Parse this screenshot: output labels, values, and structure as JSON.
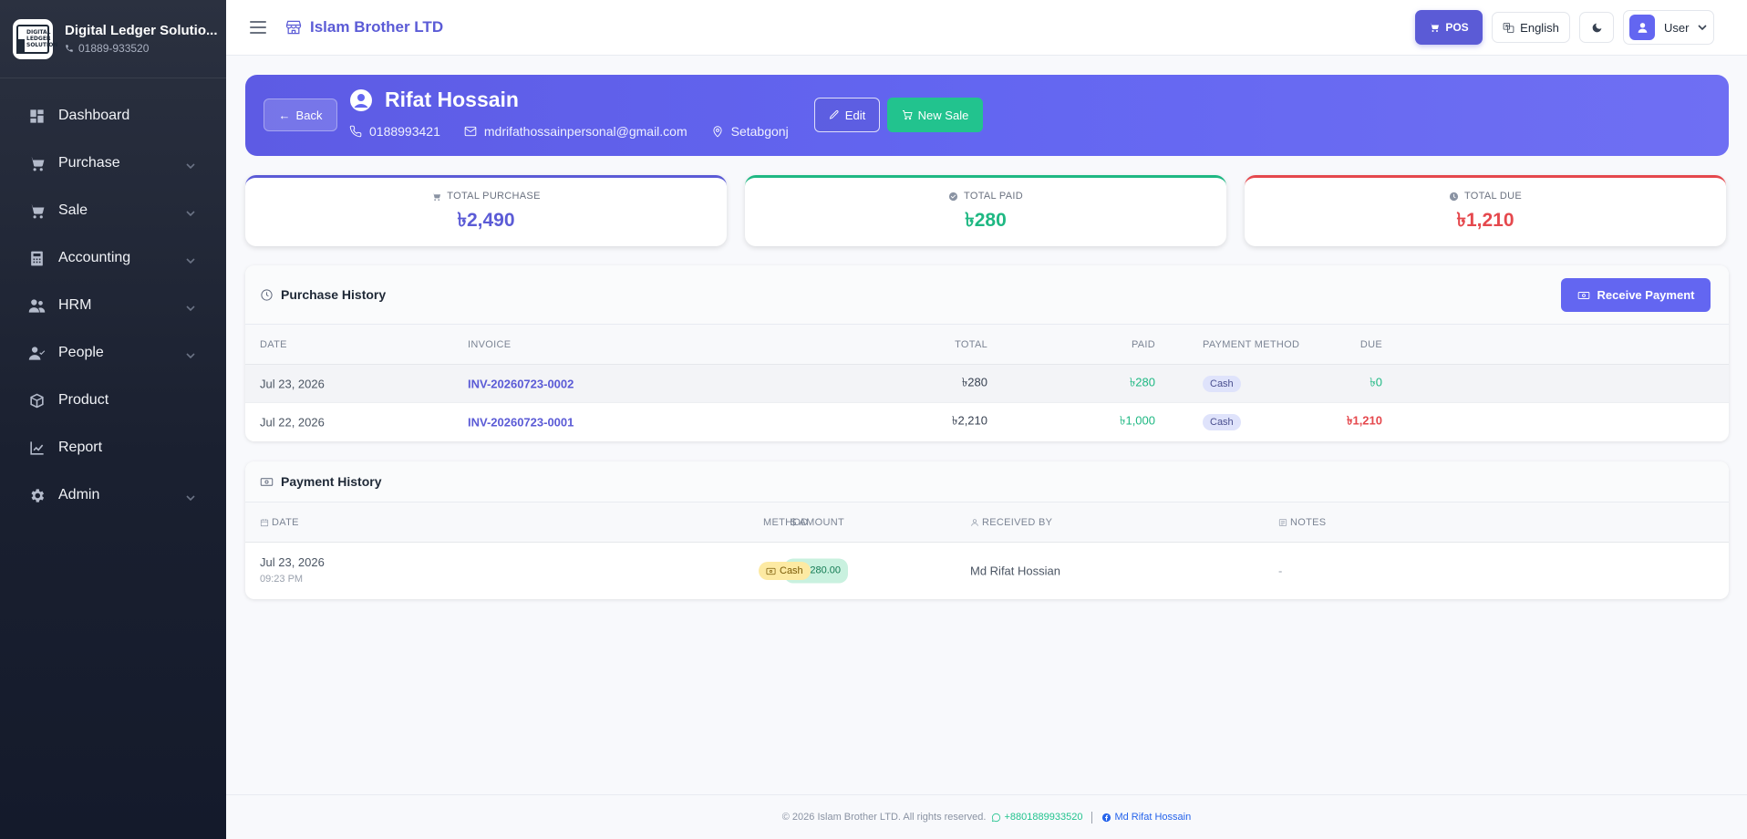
{
  "sidebar": {
    "brand_name": "Digital Ledger Solutio...",
    "brand_phone": "01889-933520",
    "logo_text": "DIGITAL LEDGER SOLUTION",
    "items": [
      {
        "label": "Dashboard",
        "icon": "dashboard-icon",
        "has_submenu": false
      },
      {
        "label": "Purchase",
        "icon": "cart-icon",
        "has_submenu": true
      },
      {
        "label": "Sale",
        "icon": "cart-icon",
        "has_submenu": true
      },
      {
        "label": "Accounting",
        "icon": "calculator-icon",
        "has_submenu": true
      },
      {
        "label": "HRM",
        "icon": "users-icon",
        "has_submenu": true
      },
      {
        "label": "People",
        "icon": "user-check-icon",
        "has_submenu": true
      },
      {
        "label": "Product",
        "icon": "box-icon",
        "has_submenu": false
      },
      {
        "label": "Report",
        "icon": "chart-icon",
        "has_submenu": false
      },
      {
        "label": "Admin",
        "icon": "gear-icon",
        "has_submenu": true
      }
    ]
  },
  "topbar": {
    "company": "Islam Brother LTD",
    "pos_label": "POS",
    "language_label": "English",
    "user_label": "User"
  },
  "customer": {
    "back_label": "Back",
    "name": "Rifat Hossain",
    "phone": "0188993421",
    "email": "mdrifathossainpersonal@gmail.com",
    "location": "Setabgonj",
    "edit_label": "Edit",
    "new_sale_label": "New Sale"
  },
  "stats": {
    "total_purchase_label": "TOTAL PURCHASE",
    "total_purchase_value": "৳2,490",
    "total_paid_label": "TOTAL PAID",
    "total_paid_value": "৳280",
    "total_due_label": "TOTAL DUE",
    "total_due_value": "৳1,210"
  },
  "purchase_history": {
    "title": "Purchase History",
    "receive_payment_label": "Receive Payment",
    "columns": {
      "date": "DATE",
      "invoice": "INVOICE",
      "total": "TOTAL",
      "paid": "PAID",
      "due": "DUE",
      "method": "PAYMENT METHOD"
    },
    "rows": [
      {
        "date": "Jul 23, 2026",
        "invoice": "INV-20260723-0002",
        "total": "৳280",
        "paid": "৳280",
        "due": "৳0",
        "method": "Cash"
      },
      {
        "date": "Jul 22, 2026",
        "invoice": "INV-20260723-0001",
        "total": "৳2,210",
        "paid": "৳1,000",
        "due": "৳1,210",
        "method": "Cash"
      }
    ]
  },
  "payment_history": {
    "title": "Payment History",
    "columns": {
      "date": "DATE",
      "amount": "AMOUNT",
      "method": "METHOD",
      "received_by": "RECEIVED BY",
      "notes": "NOTES"
    },
    "rows": [
      {
        "date": "Jul 23, 2026",
        "time": "09:23 PM",
        "amount": "৳280.00",
        "method": "Cash",
        "received_by": "Md Rifat Hossian",
        "notes": "-"
      }
    ]
  },
  "footer": {
    "copyright": "© 2026 Islam Brother LTD. All rights reserved.",
    "whatsapp": "+8801889933520",
    "author": "Md Rifat Hossain"
  }
}
